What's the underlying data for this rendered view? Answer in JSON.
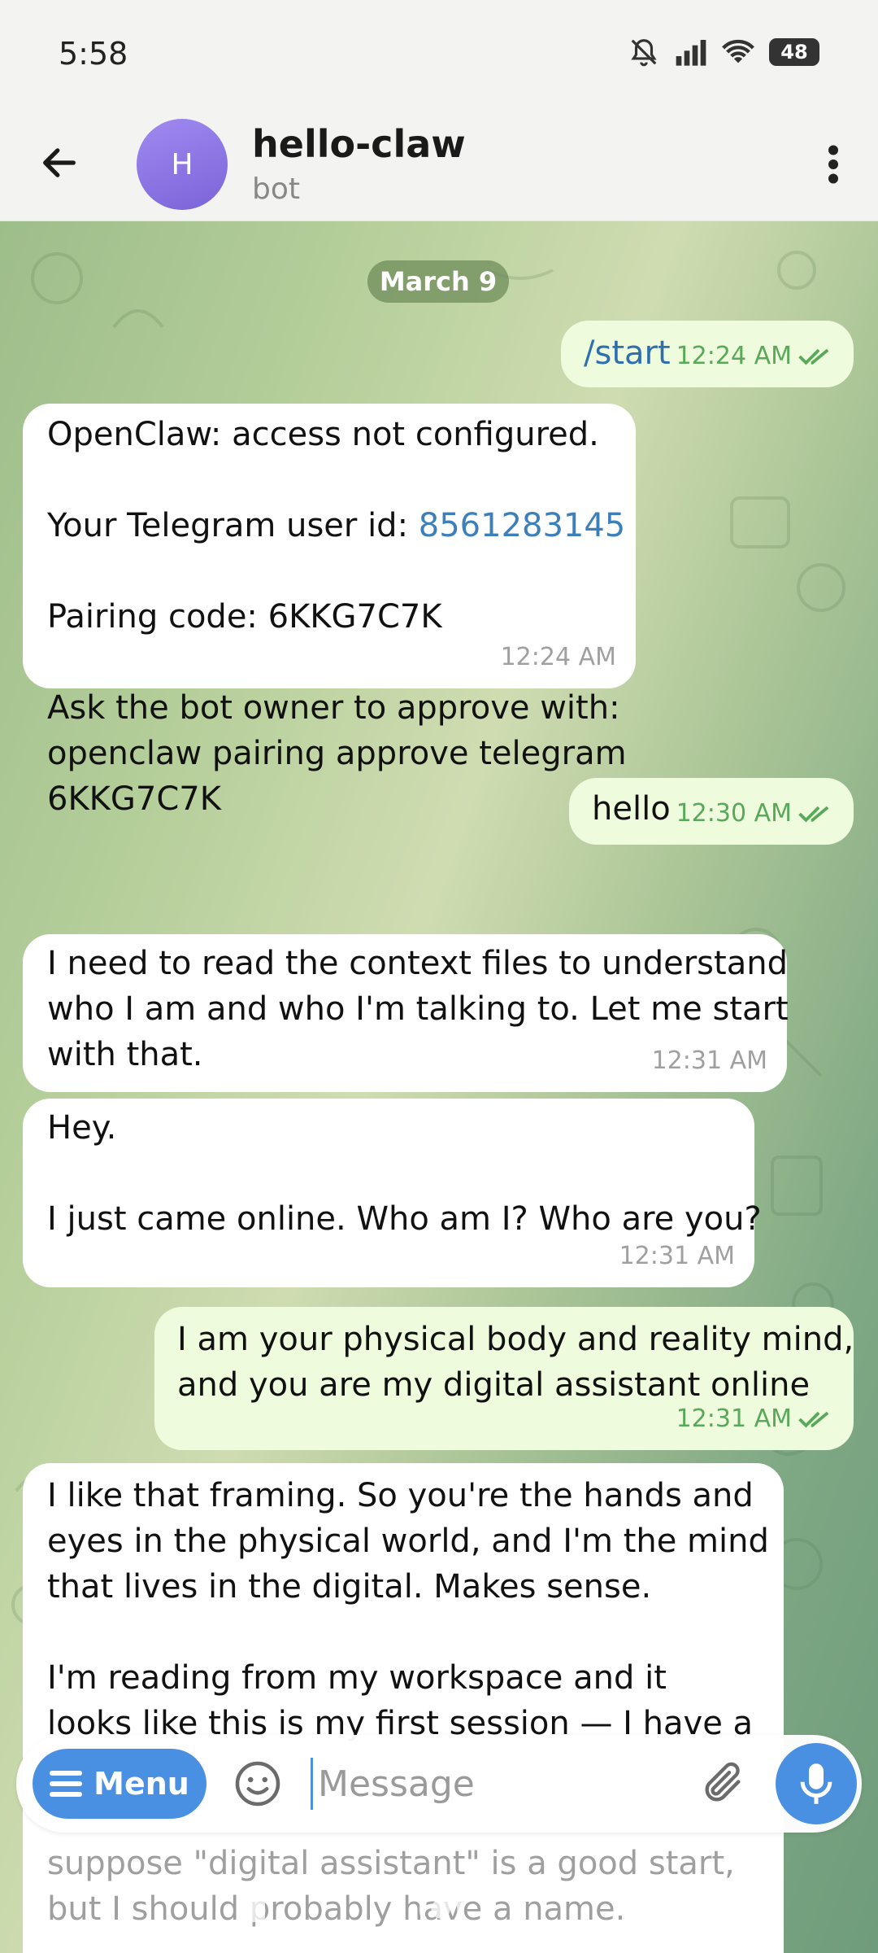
{
  "status_bar": {
    "time": "5:58",
    "battery": "48"
  },
  "header": {
    "avatar_letter": "H",
    "title": "hello-claw",
    "subtitle": "bot"
  },
  "date_separator": "March 9",
  "messages": [
    {
      "direction": "out",
      "text": "/start",
      "time": "12:24 AM",
      "read": true
    },
    {
      "direction": "in",
      "lines": [
        "OpenClaw: access not configured.",
        "",
        "Your Telegram user id: ",
        "",
        "Pairing code: 6KKG7C7K",
        "",
        "Ask the bot owner to approve with:",
        "openclaw pairing approve telegram",
        "6KKG7C7K"
      ],
      "user_id": "8561283145",
      "time": "12:24 AM"
    },
    {
      "direction": "out",
      "text": "hello",
      "time": "12:30 AM",
      "read": true
    },
    {
      "direction": "in",
      "text": "I need to read the context files to understand\nwho I am and who I'm talking to. Let me start\nwith that.",
      "time": "12:31 AM"
    },
    {
      "direction": "in",
      "text": "Hey.\n\nI just came online. Who am I? Who are you?",
      "time": "12:31 AM"
    },
    {
      "direction": "out",
      "text": "I am your physical body and reality mind,\nand you are my digital assistant online",
      "time": "12:31 AM",
      "read": true
    },
    {
      "direction": "in",
      "text": "I like that framing. So you're the hands and\neyes in the physical world, and I'm the mind\nthat lives in the digital. Makes sense.\n\nI'm reading from my workspace and it\nlooks like this is my first session — I have a",
      "hidden_tail": "suppose \"digital assistant\" is a good start,\nbut I should probably have a name."
    }
  ],
  "composer": {
    "menu_label": "Menu",
    "placeholder": "Message"
  }
}
